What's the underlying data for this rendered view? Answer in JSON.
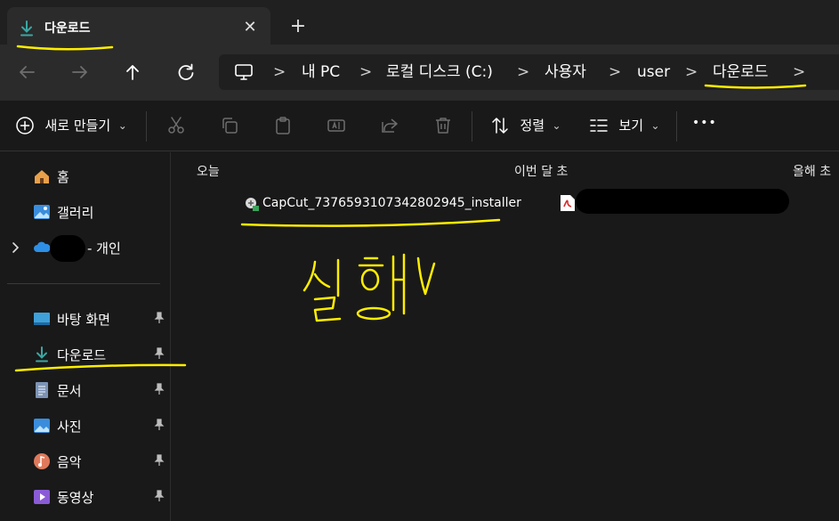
{
  "tab": {
    "title": "다운로드",
    "close_glyph": "✕",
    "new_tab_glyph": "+"
  },
  "nav": {
    "back_icon": "arrow-left-icon",
    "forward_icon": "arrow-right-icon",
    "up_icon": "arrow-up-icon",
    "refresh_icon": "refresh-icon"
  },
  "address": {
    "separator": ">",
    "crumbs": [
      "내 PC",
      "로컬 디스크 (C:)",
      "사용자",
      "user",
      "다운로드"
    ]
  },
  "commands": {
    "new_label": "새로 만들기",
    "sort_label": "정렬",
    "view_label": "보기",
    "more_glyph": "•••",
    "chevron": "⌄"
  },
  "sidebar": {
    "home": "홈",
    "gallery": "갤러리",
    "onedrive_suffix": "- 개인",
    "pinned": [
      {
        "label": "바탕 화면",
        "icon": "desktop-icon"
      },
      {
        "label": "다운로드",
        "icon": "download-icon"
      },
      {
        "label": "문서",
        "icon": "document-icon"
      },
      {
        "label": "사진",
        "icon": "pictures-icon"
      },
      {
        "label": "음악",
        "icon": "music-icon"
      },
      {
        "label": "동영상",
        "icon": "video-icon"
      }
    ]
  },
  "content": {
    "groups": [
      "오늘",
      "이번 달 초",
      "올해 초"
    ],
    "files": [
      {
        "name": "CapCut_7376593107342802945_installer",
        "icon": "installer-icon"
      }
    ]
  },
  "annotation": {
    "handwritten_text": "실행"
  },
  "colors": {
    "accent_download": "#3aa7a3",
    "annotation_yellow": "#ffee00",
    "background": "#191919",
    "toolbar": "#2b2b2b"
  }
}
